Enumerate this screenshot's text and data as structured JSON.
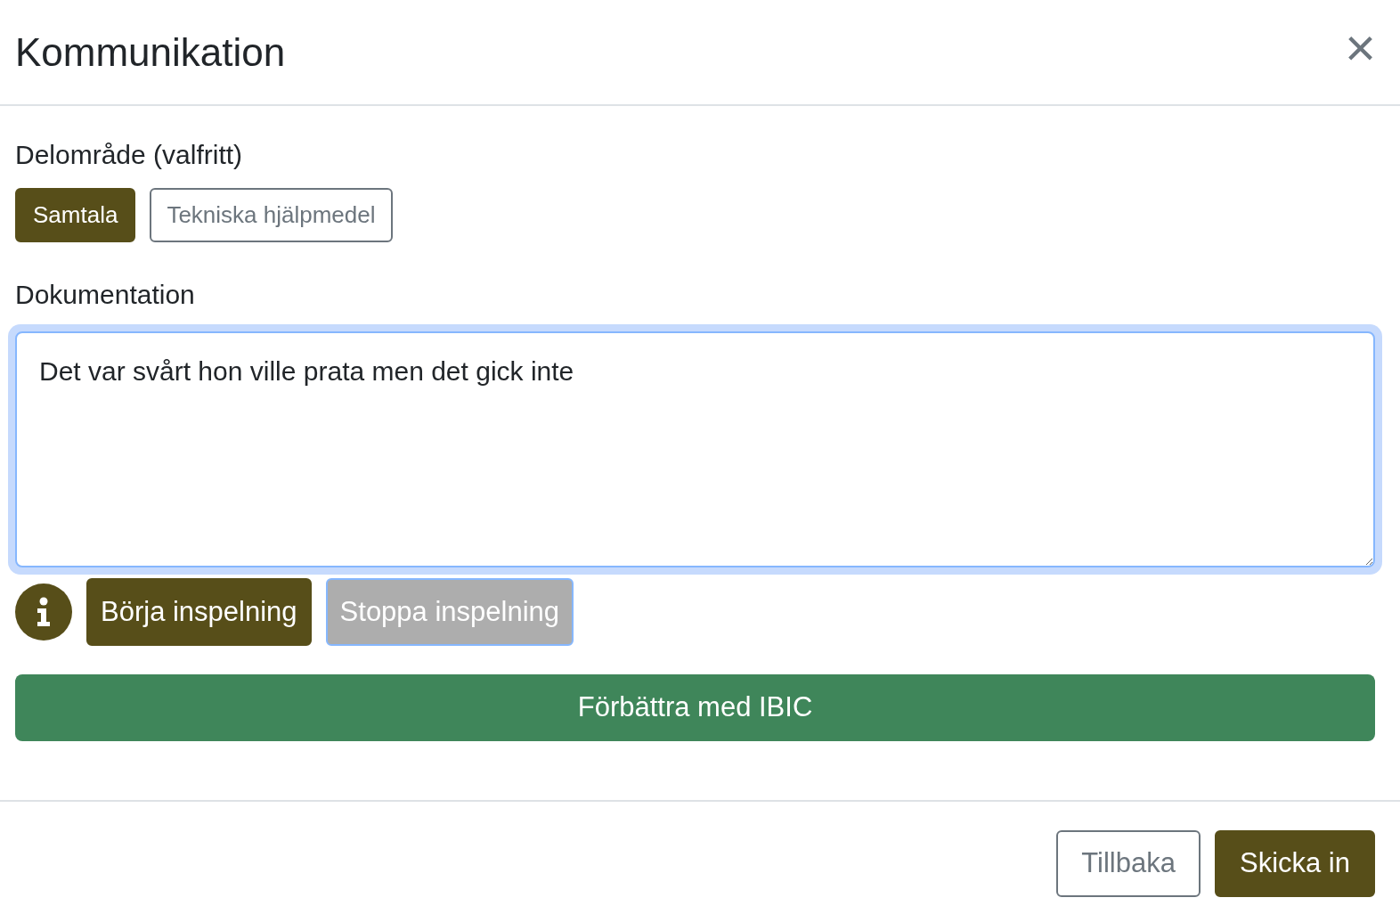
{
  "dialog": {
    "title": "Kommunikation",
    "close": "×"
  },
  "subarea": {
    "label": "Delområde (valfritt)",
    "options": [
      {
        "label": "Samtala",
        "selected": true
      },
      {
        "label": "Tekniska hjälpmedel",
        "selected": false
      }
    ]
  },
  "documentation": {
    "label": "Dokumentation",
    "value": "Det var svårt hon ville prata men det gick inte",
    "focused": true
  },
  "recording": [
    {
      "label": "Börja inspelning",
      "disabled": false
    },
    {
      "label": "Stoppa inspelning",
      "disabled": true
    }
  ],
  "improve_button": "Förbättra med IBIC",
  "footer": {
    "buttons": [
      {
        "label": "Tillbaka",
        "kind": "secondary"
      },
      {
        "label": "Skicka in",
        "kind": "primary"
      }
    ]
  }
}
